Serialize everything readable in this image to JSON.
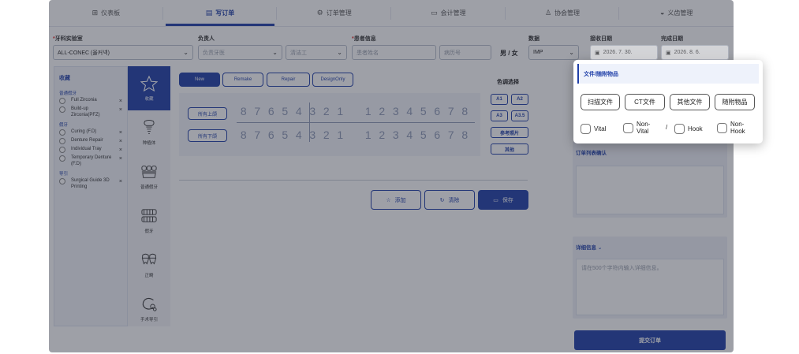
{
  "nav": {
    "tabs": [
      {
        "label": "仪表板",
        "icon": "grid-icon"
      },
      {
        "label": "写订单",
        "icon": "document-icon"
      },
      {
        "label": "订单管理",
        "icon": "gear-icon"
      },
      {
        "label": "会计管理",
        "icon": "card-icon"
      },
      {
        "label": "协会管理",
        "icon": "user-icon"
      },
      {
        "label": "义齿管理",
        "icon": "denture-icon"
      }
    ],
    "active": 1
  },
  "form": {
    "lab_label": "牙科实验室",
    "lab_value": "ALL-CONEC (올커넥)",
    "owner_label": "负责人",
    "owner_placeholder": "负责牙医",
    "cleaner_placeholder": "清洁工",
    "patient_label": "患者信息",
    "patient_name_placeholder": "患者姓名",
    "record_placeholder": "病历号",
    "gender_text": "男 / 女",
    "data_label": "数据",
    "data_value": "IMP",
    "received_label": "接收日期",
    "received_value": "2026. 7. 30.",
    "done_label": "完成日期",
    "done_value": "2026. 8. 6."
  },
  "favorites": {
    "title": "收藏",
    "groups": [
      {
        "name": "普通假牙",
        "items": [
          "Full Zirconia",
          "Build-up Zirconia(PFZ)"
        ]
      },
      {
        "name": "假牙",
        "items": [
          "Curing (F.D)",
          "Denture Repair",
          "Individual Tray",
          "Temporary Denture (F.D)"
        ]
      },
      {
        "name": "导引",
        "items": [
          "Surgical Guide 3D Printing"
        ]
      }
    ]
  },
  "categories": [
    {
      "label": "收藏",
      "icon": "star-icon"
    },
    {
      "label": "种植体",
      "icon": "implant-icon"
    },
    {
      "label": "普通假牙",
      "icon": "crown-icon"
    },
    {
      "label": "假牙",
      "icon": "denture-icon"
    },
    {
      "label": "正畸",
      "icon": "ortho-icon"
    },
    {
      "label": "手术导引",
      "icon": "guide-icon"
    }
  ],
  "order_types": [
    "New",
    "Remake",
    "Repair",
    "DesignOnly"
  ],
  "jaw": {
    "upper_label": "所有上颌",
    "lower_label": "所有下颌",
    "left_numbers": [
      "8",
      "7",
      "6",
      "5",
      "4",
      "3",
      "2",
      "1"
    ],
    "right_numbers": [
      "1",
      "2",
      "3",
      "4",
      "5",
      "6",
      "7",
      "8"
    ]
  },
  "shade": {
    "title": "色调选择",
    "a1": "A1",
    "a2": "A2",
    "a3": "A3",
    "a35": "A3.5",
    "ref": "参考照片",
    "other": "其他"
  },
  "actions": {
    "add": "添加",
    "clear": "清除",
    "save": "保存"
  },
  "right": {
    "order_confirm": "订单列表确认",
    "details": "详细信息",
    "details_placeholder": "请在500个字符内输入详细信息。",
    "submit": "提交订单"
  },
  "popup": {
    "title": "文件/随附物品",
    "buttons": [
      "扫描文件",
      "CT文件",
      "其他文件",
      "随附物品"
    ],
    "vital": "Vital",
    "nonvital": "Non-\nVital",
    "slash": "/",
    "hook": "Hook",
    "nonhook": "Non-\nHook"
  },
  "colors": {
    "accent": "#1f3fa8",
    "required": "#e0322e"
  }
}
